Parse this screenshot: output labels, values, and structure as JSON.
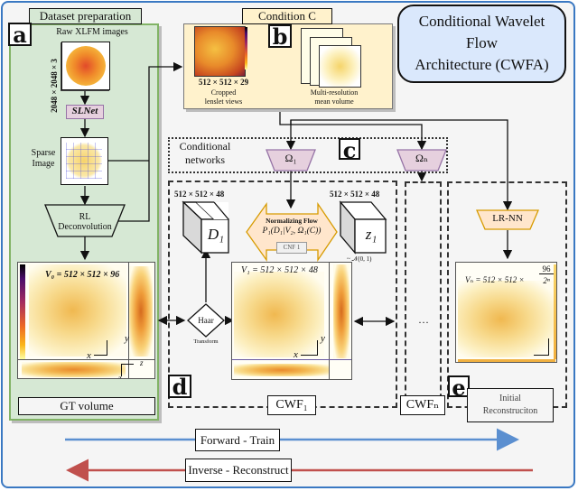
{
  "title": "Conditional Wavelet Flow Architecture (CWFA)",
  "title_lines": [
    "Conditional Wavelet",
    "Flow",
    "Architecture (CWFA)"
  ],
  "panel_a": {
    "letter": "a",
    "tab": "Dataset preparation",
    "raw_label": "Raw XLFM images",
    "raw_dims": "2048 × 2048 × 3",
    "slnet": "SLNet",
    "sparse_label_1": "Sparse",
    "sparse_label_2": "Image",
    "rl_1": "RL",
    "rl_2": "Deconvolution",
    "v0_label": "V₀ = 512 × 512 × 96",
    "axis_x": "x",
    "axis_y": "y",
    "axis_z1": "z",
    "axis_z2": "z",
    "gt_label": "GT volume"
  },
  "panel_b": {
    "letter": "b",
    "title": "Condition C",
    "lenslet_dims": "512 × 512 × 29",
    "lenslet_caption_1": "Cropped",
    "lenslet_caption_2": "lenslet views",
    "mean_caption_1": "Multi-resolution",
    "mean_caption_2": "mean volume"
  },
  "panel_c": {
    "letter": "c",
    "label_1": "Conditional",
    "label_2": "networks",
    "omega_1": "Ω₁",
    "omega_n": "Ωₙ"
  },
  "panel_d": {
    "letter": "d",
    "d1_dims": "512 × 512 × 48",
    "z1_dims": "512 × 512 × 48",
    "d1_label": "D₁",
    "z1_label": "z₁",
    "z1_dist": "~ 𝒩(0, 1)",
    "flow_title": "Normalizing Flow",
    "flow_formula": "P₁(D₁|V₂, Ω₁(C))",
    "cnf_label": "CNF 1",
    "haar_1": "Haar",
    "haar_2": "Transform",
    "v1_label": "V₁ = 512 × 512 × 48",
    "axis_x": "x",
    "axis_y": "y",
    "cwf1_label": "CWF₁",
    "ellipsis": "···",
    "cwfn_label": "CWFₙ"
  },
  "panel_e": {
    "letter": "e",
    "lrnn": "LR-NN",
    "vn_label": "Vₙ = 512 × 512 ×",
    "vn_num": "96",
    "vn_den": "2ⁿ",
    "caption_1": "Initial",
    "caption_2": "Reconstruciton"
  },
  "legend": {
    "forward": "Forward - Train",
    "inverse": "Inverse - Reconstruct",
    "forward_color": "#5b8fd0",
    "inverse_color": "#c0504d"
  },
  "colors": {
    "frame_border": "#3a78c2",
    "dataset_bg": "#d6e8d4",
    "dataset_border": "#82b366",
    "condition_bg": "#fff2cc",
    "title_bg": "#dae8fc",
    "omega_fill": "#e6d0de",
    "omega_stroke": "#9673a6",
    "flow_fill": "#ffe6cc",
    "flow_stroke": "#d79b00"
  }
}
